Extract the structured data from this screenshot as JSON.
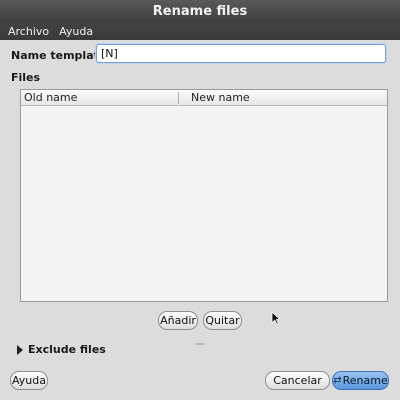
{
  "window": {
    "title": "Rename files"
  },
  "menubar": {
    "items": [
      "Archivo",
      "Ayuda"
    ]
  },
  "template": {
    "label": "Name template:",
    "value": "[N]"
  },
  "files": {
    "label": "Files",
    "columns": [
      "Old name",
      "New name"
    ]
  },
  "buttons": {
    "add": "Añadir",
    "remove": "Quitar",
    "help": "Ayuda",
    "cancel": "Cancelar",
    "rename": "Rename"
  },
  "exclude": {
    "label": "Exclude files",
    "expanded": false
  },
  "colors": {
    "accent": "#5b97dd",
    "titlebar": "#4a4a4a",
    "focus_border": "#7aa0cf"
  }
}
